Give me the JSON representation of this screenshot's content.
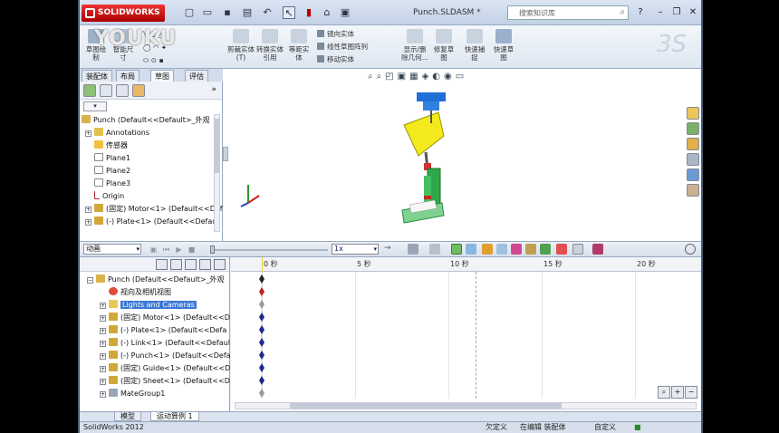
{
  "app": {
    "logo_text": "SOLIDWORKS",
    "doc_title": "Punch.SLDASM *",
    "help_search_placeholder": "搜索知识库",
    "watermark": "YOUKU"
  },
  "ribbon": {
    "items": [
      {
        "label": "草图绘制"
      },
      {
        "label": "智能尺寸"
      },
      {
        "label": "剪裁实体(T)"
      },
      {
        "label": "转换实体引用"
      },
      {
        "label": "等距实体"
      },
      {
        "label": "显示/删除几何..."
      },
      {
        "label": "修复草图"
      },
      {
        "label": "快速捕捉"
      },
      {
        "label": "快速草图"
      }
    ],
    "small_items": [
      {
        "label": "镜向实体"
      },
      {
        "label": "线性草图阵列"
      },
      {
        "label": "移动实体"
      }
    ]
  },
  "cm_tabs": [
    "装配体",
    "布局",
    "草图",
    "评估"
  ],
  "cm_tabs_active": 2,
  "feature_tree": {
    "root": "Punch  (Default<<Default>_外观",
    "items": [
      {
        "label": "Annotations",
        "icon": "annotations-icon"
      },
      {
        "label": "传感器",
        "icon": "sensor-icon"
      },
      {
        "label": "Plane1",
        "icon": "plane-icon"
      },
      {
        "label": "Plane2",
        "icon": "plane-icon"
      },
      {
        "label": "Plane3",
        "icon": "plane-icon"
      },
      {
        "label": "Origin",
        "icon": "origin-icon"
      },
      {
        "label": "(固定) Motor<1> (Default<<Def",
        "icon": "part-icon"
      },
      {
        "label": "(-) Plate<1> (Default<<Defau",
        "icon": "part-icon"
      }
    ]
  },
  "motion_manager": {
    "study_type": "动画",
    "speed": "1x",
    "ruler_ticks": [
      "0 秒",
      "5 秒",
      "10 秒",
      "15 秒",
      "20 秒"
    ],
    "tree_root": "Punch  (Default<<Default>_外观",
    "tree_items": [
      {
        "label": "视向及相机视图",
        "icon": "camera-view-icon",
        "selected": false
      },
      {
        "label": "Lights and Cameras",
        "icon": "lights-icon",
        "selected": true
      },
      {
        "label": "(固定) Motor<1> (Default<<D",
        "icon": "part-icon",
        "selected": false
      },
      {
        "label": "(-) Plate<1> (Default<<Defa",
        "icon": "part-icon",
        "selected": false
      },
      {
        "label": "(-) Link<1> (Default<<Defaul",
        "icon": "part-icon",
        "selected": false
      },
      {
        "label": "(-) Punch<1> (Default<<Defa",
        "icon": "part-icon",
        "selected": false
      },
      {
        "label": "(固定) Guide<1> (Default<<D",
        "icon": "part-icon",
        "selected": false
      },
      {
        "label": "(固定) Sheet<1> (Default<<D",
        "icon": "part-icon",
        "selected": false
      },
      {
        "label": "MateGroup1",
        "icon": "mategroup-icon",
        "selected": false
      }
    ]
  },
  "bottom_tabs": [
    "模型",
    "运动算例 1"
  ],
  "bottom_tabs_active": 1,
  "status": {
    "app_version": "SolidWorks 2012",
    "under_defined": "欠定义",
    "editing": "在编辑 装配体",
    "custom": "自定义"
  },
  "colors": {
    "selection": "#3a78d4",
    "key_point": "#1e2a8a",
    "logo_red": "#cc2222"
  }
}
